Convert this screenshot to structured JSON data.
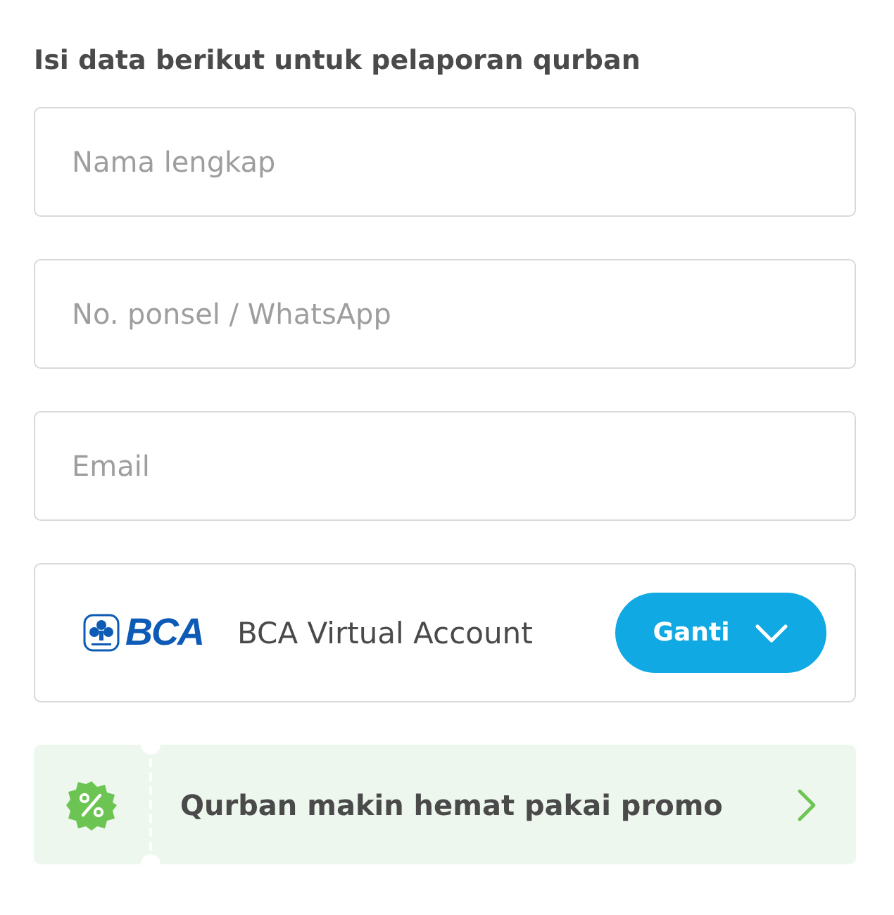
{
  "heading": "Isi data berikut untuk pelaporan qurban",
  "fields": [
    {
      "placeholder": "Nama lengkap"
    },
    {
      "placeholder": "No. ponsel / WhatsApp"
    },
    {
      "placeholder": "Email"
    }
  ],
  "payment": {
    "logo_text": "BCA",
    "method": "BCA Virtual Account",
    "button": "Ganti"
  },
  "promo": {
    "label": "Qurban makin hemat pakai promo"
  }
}
